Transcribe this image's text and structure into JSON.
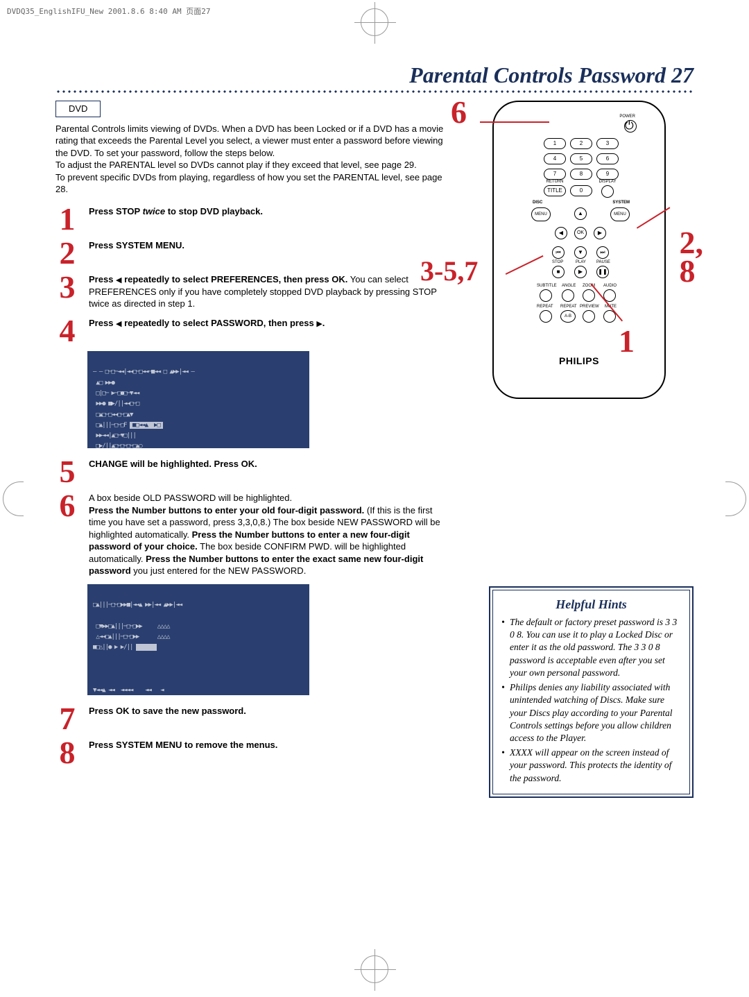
{
  "header_strip": "DVDQ35_EnglishIFU_New  2001.8.6 8:40 AM  页面27",
  "title": "Parental Controls Password  27",
  "dvd_badge": "DVD",
  "intro": {
    "p1": "Parental Controls limits viewing of DVDs. When a DVD has been Locked or if a DVD has a movie rating that exceeds the Parental Level you select, a viewer must enter a password before viewing the DVD. To set your password, follow the steps below.",
    "p2": "To adjust the PARENTAL level so DVDs cannot play if they exceed that level, see page 29.",
    "p3": "To prevent specific DVDs from playing, regardless of how you set the PARENTAL level, see page 28."
  },
  "steps": {
    "s1_num": "1",
    "s1": "Press STOP twice to stop DVD playback.",
    "s2_num": "2",
    "s2": "Press SYSTEM MENU.",
    "s3_num": "3",
    "s3a": "Press ",
    "s3b": " repeatedly to select PREFERENCES, then press OK.",
    "s3c": " You can select PREFERENCES only if you have completely stopped DVD playback by pressing STOP twice as directed in step 1.",
    "s4_num": "4",
    "s4a": "Press ",
    "s4b": " repeatedly to select PASSWORD, then press ",
    "s4c": ".",
    "s5_num": "5",
    "s5": "CHANGE will be highlighted. Press OK.",
    "s6_num": "6",
    "s6a": "A box beside OLD PASSWORD will be highlighted.",
    "s6b": "Press the Number buttons to enter your old four-digit password.",
    "s6c": " (If this is the first time you have set a password, press 3,3,0,8.) The box beside NEW PASSWORD will be highlighted automatically. ",
    "s6d": "Press the Number buttons to enter a new four-digit password of your choice.",
    "s6e": " The box beside CONFIRM PWD. will be highlighted automatically. ",
    "s6f": "Press the Number buttons to enter the exact same new four-digit password",
    "s6g": " you just entered for the NEW PASSWORD.",
    "s7_num": "7",
    "s7": "Press OK to save the new password.",
    "s8_num": "8",
    "s8": "Press SYSTEM MENU to remove the menus."
  },
  "remote": {
    "power": "POWER",
    "n1": "1",
    "n2": "2",
    "n3": "3",
    "n4": "4",
    "n5": "5",
    "n6": "6",
    "n7": "7",
    "n8": "8",
    "n9": "9",
    "n0": "0",
    "return": "RETURN",
    "title": "TITLE",
    "display": "DISPLAY",
    "disc": "DISC",
    "system": "SYSTEM",
    "menu": "MENU",
    "ok": "OK",
    "stop": "STOP",
    "play": "PLAY",
    "pause": "PAUSE",
    "subtitle": "SUBTITLE",
    "angle": "ANGLE",
    "zoom": "ZOOM",
    "audio": "AUDIO",
    "repeat": "REPEAT",
    "repeat2": "REPEAT",
    "preview": "PREVIEW",
    "mute": "MUTE",
    "ab": "A-B",
    "brand": "PHILIPS"
  },
  "callouts": {
    "c6": "6",
    "c28": "2,\n8",
    "c357": "3-5,7",
    "c1": "1"
  },
  "hints": {
    "title": "Helpful Hints",
    "h1": "The default or factory preset password is 3 3 0 8. You can use it to play a Locked Disc or enter it as the old password. The 3 3 0 8 password is acceptable even after you set your own personal password.",
    "h2": "Philips denies any liability associated with unintended watching of Discs. Make sure your Discs play according to your Parental Controls settings before you allow children access to the Player.",
    "h3": "XXXX will appear on the screen instead of your password. This protects the identity of the password."
  }
}
